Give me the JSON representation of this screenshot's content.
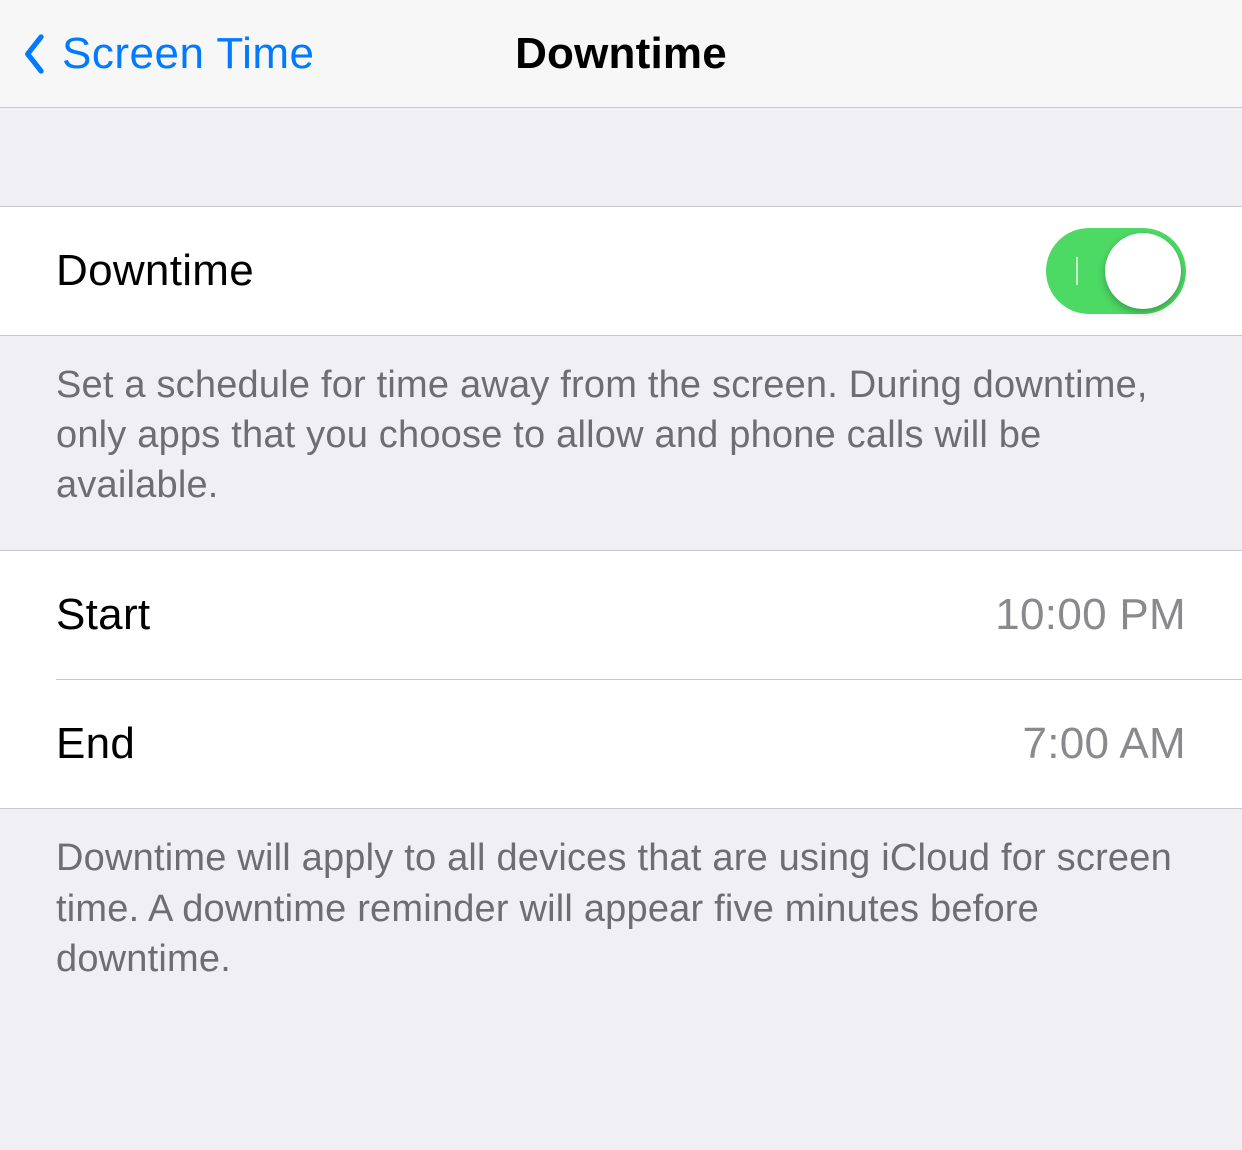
{
  "nav": {
    "back_label": "Screen Time",
    "title": "Downtime"
  },
  "toggle_section": {
    "label": "Downtime",
    "enabled": true,
    "footer": "Set a schedule for time away from the screen. During downtime, only apps that you choose to allow and phone calls will be available."
  },
  "schedule": {
    "start_label": "Start",
    "start_value": "10:00 PM",
    "end_label": "End",
    "end_value": "7:00 AM",
    "footer": "Downtime will apply to all devices that are using iCloud for screen time. A downtime reminder will appear five minutes before downtime."
  },
  "colors": {
    "link": "#007aff",
    "toggle_on": "#4cd964",
    "background": "#efeff4",
    "secondary_text": "#8a8a8e"
  }
}
